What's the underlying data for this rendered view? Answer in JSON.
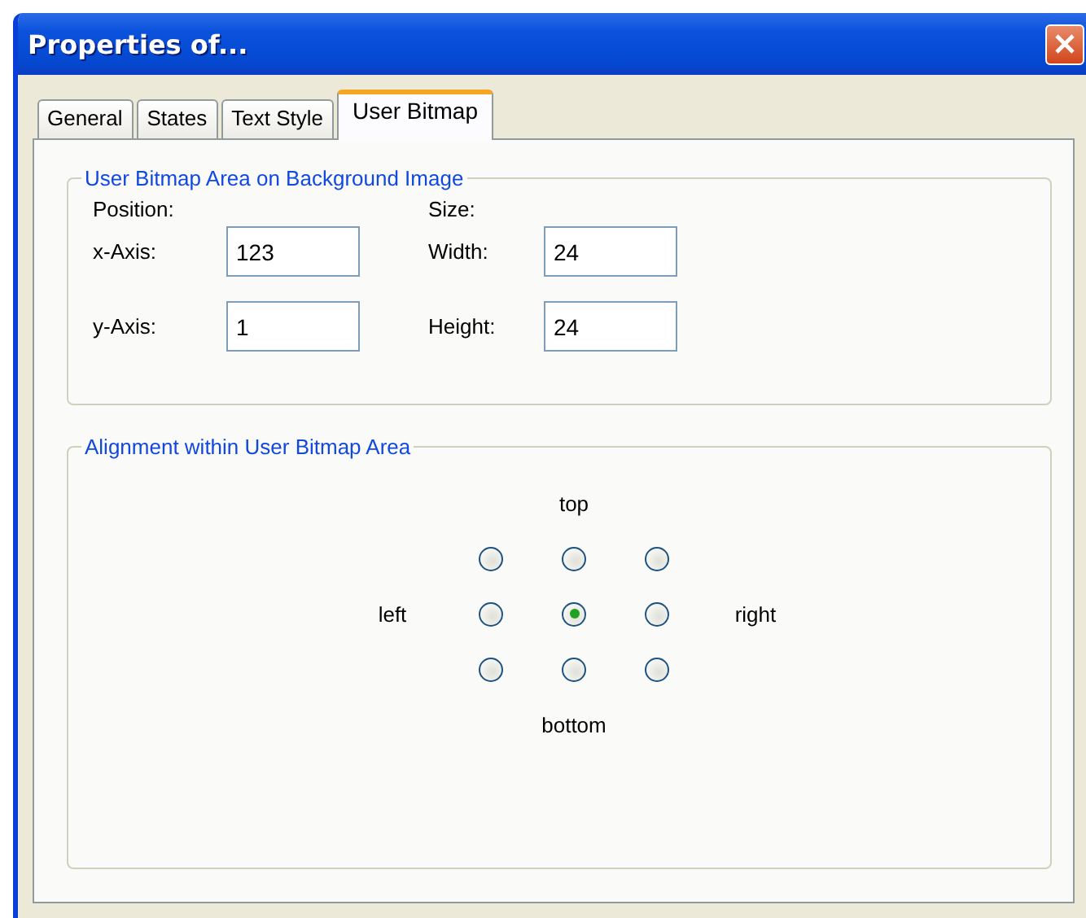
{
  "window": {
    "title": "Properties of..."
  },
  "tabs": [
    {
      "label": "General",
      "selected": false
    },
    {
      "label": "States",
      "selected": false
    },
    {
      "label": "Text Style",
      "selected": false
    },
    {
      "label": "User Bitmap",
      "selected": true
    }
  ],
  "area_group": {
    "title": "User Bitmap Area on Background Image",
    "position_label": "Position:",
    "size_label": "Size:",
    "fields": [
      {
        "label": "x-Axis:",
        "value": "123"
      },
      {
        "label": "Width:",
        "value": "24"
      },
      {
        "label": "y-Axis:",
        "value": "1"
      },
      {
        "label": "Height:",
        "value": "24"
      }
    ]
  },
  "alignment_group": {
    "title": "Alignment within User Bitmap Area",
    "top": "top",
    "left": "left",
    "right": "right",
    "bottom": "bottom",
    "options": [
      {
        "selected": false
      },
      {
        "selected": false
      },
      {
        "selected": false
      },
      {
        "selected": false
      },
      {
        "selected": true
      },
      {
        "selected": false
      },
      {
        "selected": false
      },
      {
        "selected": false
      },
      {
        "selected": false
      }
    ]
  }
}
